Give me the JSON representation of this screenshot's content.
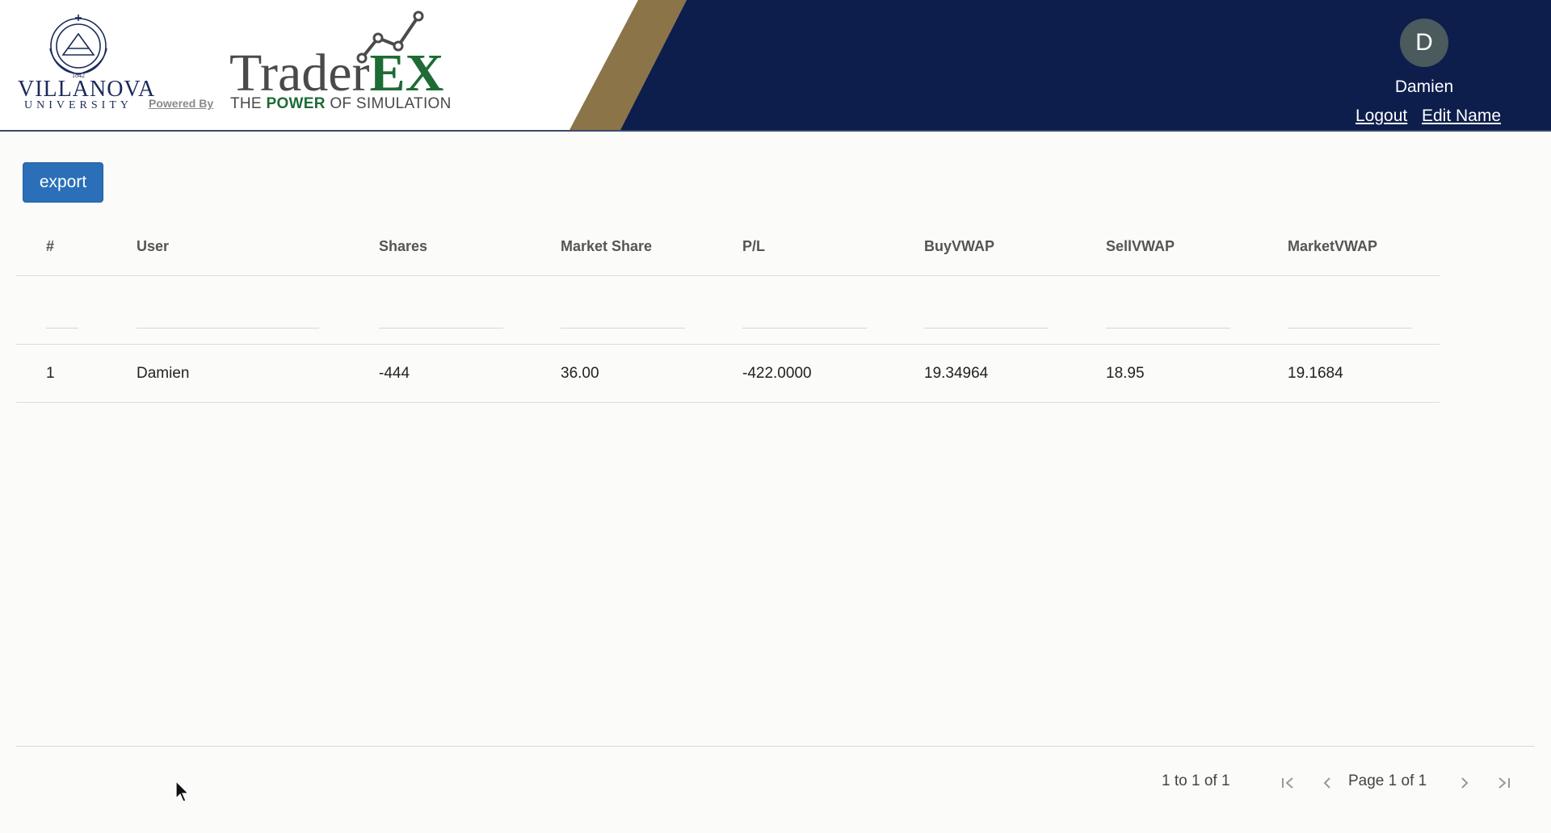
{
  "header": {
    "university_name": "VILLANOVA",
    "university_sub": "UNIVERSITY",
    "powered_by": "Powered By",
    "brand_trader": "Trader",
    "brand_ex": "EX",
    "tagline_pre": "THE ",
    "tagline_power": "POWER",
    "tagline_post": " OF SIMULATION",
    "avatar_initial": "D",
    "user_name": "Damien",
    "logout_label": "Logout",
    "edit_name_label": "Edit Name",
    "colors": {
      "navy": "#0d1e4c",
      "gold": "#8a7448",
      "green": "#1e6b35"
    }
  },
  "toolbar": {
    "export_label": "export",
    "export_color": "#2a6fb8"
  },
  "grid": {
    "columns": [
      "#",
      "User",
      "Shares",
      "Market Share",
      "P/L",
      "BuyVWAP",
      "SellVWAP",
      "MarketVWAP"
    ],
    "rows": [
      [
        "1",
        "Damien",
        "-444",
        "36.00",
        "-422.0000",
        "19.34964",
        "18.95",
        "19.1684"
      ]
    ]
  },
  "pagination": {
    "row_summary": "1 to 1 of 1",
    "page_summary": "Page 1 of 1",
    "icons": [
      "first-page-icon",
      "previous-page-icon",
      "next-page-icon",
      "last-page-icon"
    ]
  }
}
